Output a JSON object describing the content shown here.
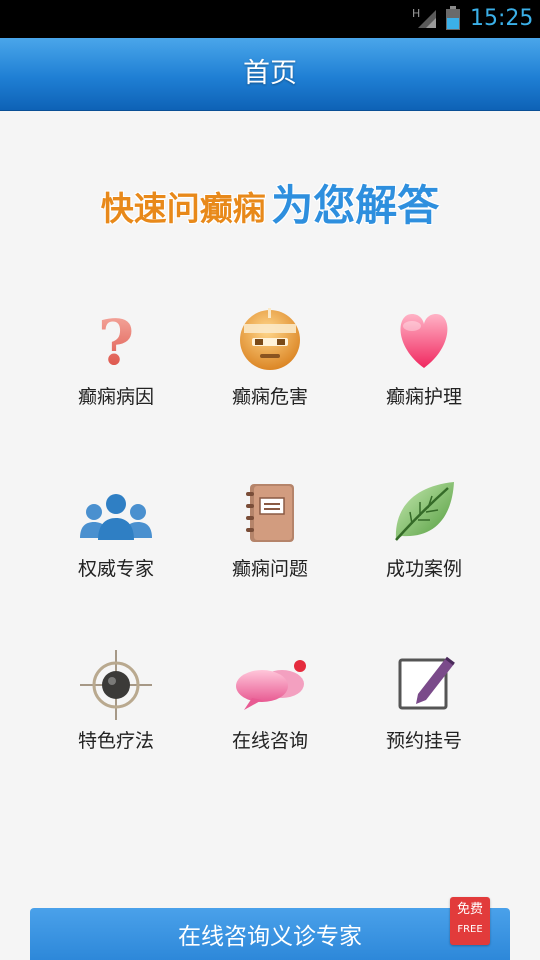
{
  "status_bar": {
    "network": "H",
    "time": "15:25"
  },
  "header": {
    "title": "首页"
  },
  "slogan": {
    "part1": "快速问癫痫",
    "part2": "为您解答"
  },
  "menu": {
    "items": [
      {
        "label": "癫痫病因",
        "icon": "question-mark-icon"
      },
      {
        "label": "癫痫危害",
        "icon": "bandaged-face-icon"
      },
      {
        "label": "癫痫护理",
        "icon": "heart-icon"
      },
      {
        "label": "权威专家",
        "icon": "people-group-icon"
      },
      {
        "label": "癫痫问题",
        "icon": "notebook-icon"
      },
      {
        "label": "成功案例",
        "icon": "leaf-icon"
      },
      {
        "label": "特色疗法",
        "icon": "crosshair-icon"
      },
      {
        "label": "在线咨询",
        "icon": "chat-bubbles-icon"
      },
      {
        "label": "预约挂号",
        "icon": "edit-note-icon"
      }
    ]
  },
  "bottom": {
    "consult_label": "在线咨询义诊专家",
    "badge_cn": "免费",
    "badge_en": "FREE"
  },
  "colors": {
    "header_blue": "#1f7fd4",
    "slogan_orange": "#e8891a",
    "slogan_blue": "#2e8fde",
    "badge_red": "#e23b3b",
    "time_blue": "#3bb0e8"
  }
}
